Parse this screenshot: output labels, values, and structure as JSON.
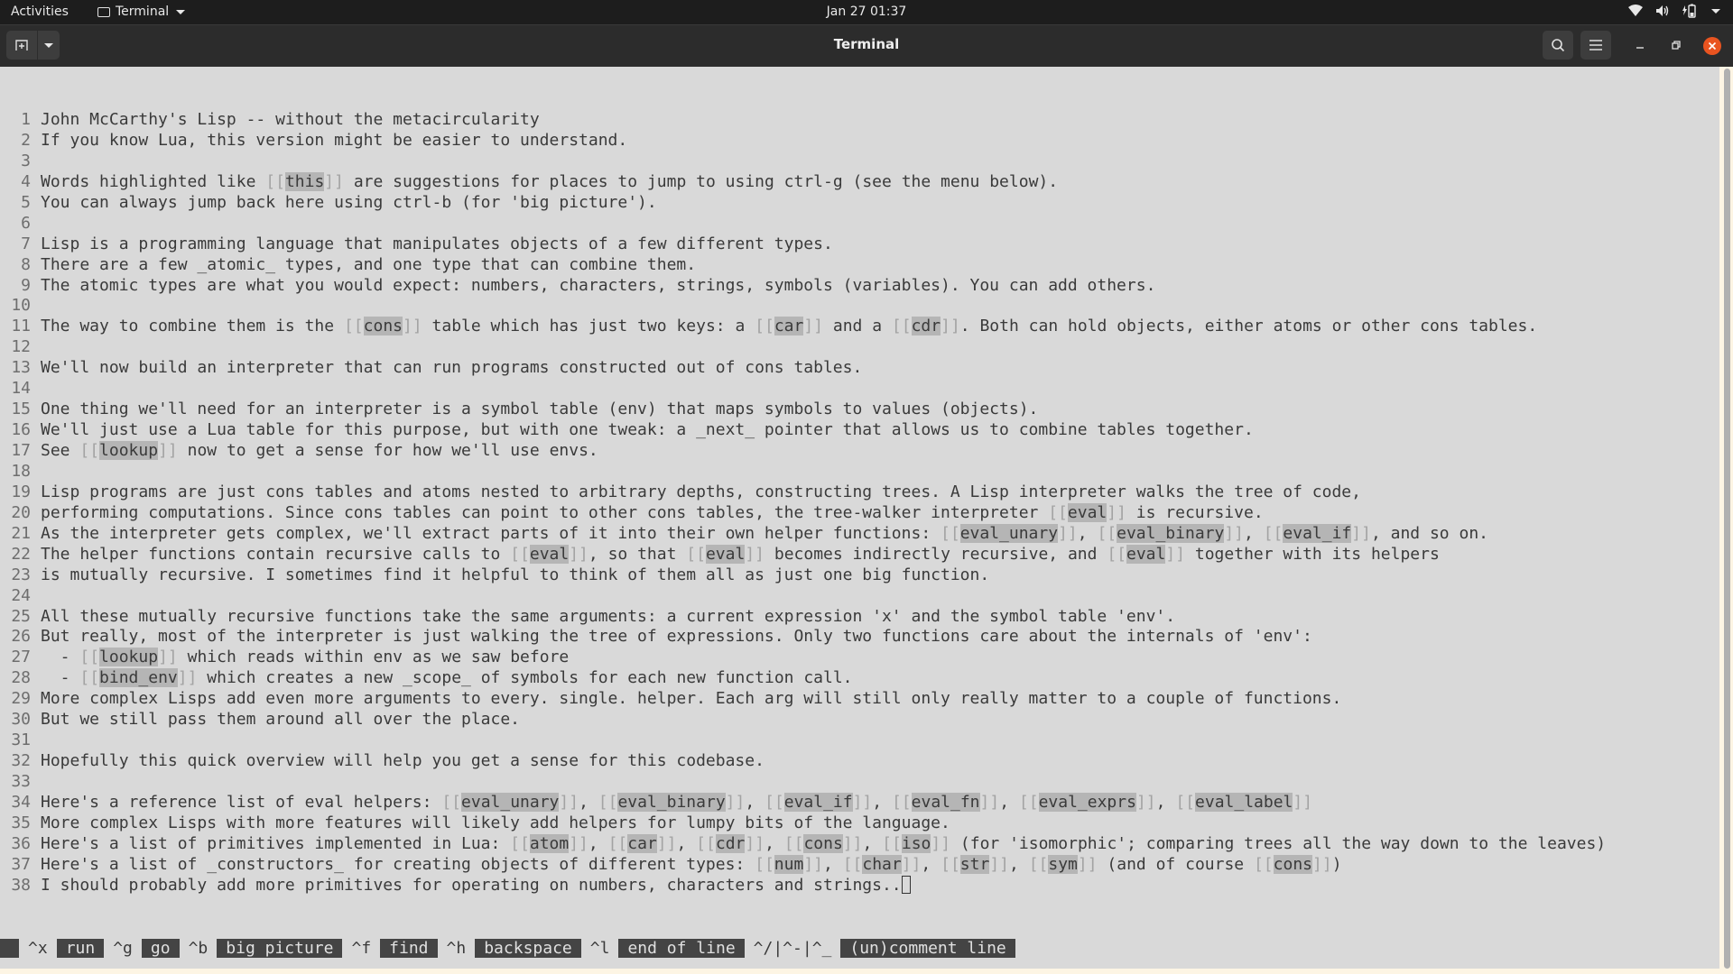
{
  "topbar": {
    "activities": "Activities",
    "app_name": "Terminal",
    "clock": "Jan 27  01:37",
    "tray_icons": [
      "wifi-icon",
      "volume-icon",
      "battery-icon",
      "system-menu-icon"
    ]
  },
  "window": {
    "title": "Terminal"
  },
  "terminal": {
    "lines": [
      [
        {
          "t": "John McCarthy's Lisp -- without the metacircularity"
        }
      ],
      [
        {
          "t": "If you know Lua, this version might be easier to understand."
        }
      ],
      [],
      [
        {
          "t": "Words highlighted like "
        },
        {
          "link": "this"
        },
        {
          "t": " are suggestions for places to jump to using ctrl-g (see the menu below)."
        }
      ],
      [
        {
          "t": "You can always jump back here using ctrl-b (for 'big picture')."
        }
      ],
      [],
      [
        {
          "t": "Lisp is a programming language that manipulates objects of a few different types."
        }
      ],
      [
        {
          "t": "There are a few _atomic_ types, and one type that can combine them."
        }
      ],
      [
        {
          "t": "The atomic types are what you would expect: numbers, characters, strings, symbols (variables). You can add others."
        }
      ],
      [],
      [
        {
          "t": "The way to combine them is the "
        },
        {
          "link": "cons"
        },
        {
          "t": " table which has just two keys: a "
        },
        {
          "link": "car"
        },
        {
          "t": " and a "
        },
        {
          "link": "cdr"
        },
        {
          "t": ". Both can hold objects, either atoms or other cons tables."
        }
      ],
      [],
      [
        {
          "t": "We'll now build an interpreter that can run programs constructed out of cons tables."
        }
      ],
      [],
      [
        {
          "t": "One thing we'll need for an interpreter is a symbol table (env) that maps symbols to values (objects)."
        }
      ],
      [
        {
          "t": "We'll just use a Lua table for this purpose, but with one tweak: a _next_ pointer that allows us to combine tables together."
        }
      ],
      [
        {
          "t": "See "
        },
        {
          "link": "lookup"
        },
        {
          "t": " now to get a sense for how we'll use envs."
        }
      ],
      [],
      [
        {
          "t": "Lisp programs are just cons tables and atoms nested to arbitrary depths, constructing trees. A Lisp interpreter walks the tree of code,"
        }
      ],
      [
        {
          "t": "performing computations. Since cons tables can point to other cons tables, the tree-walker interpreter "
        },
        {
          "link": "eval"
        },
        {
          "t": " is recursive."
        }
      ],
      [
        {
          "t": "As the interpreter gets complex, we'll extract parts of it into their own helper functions: "
        },
        {
          "link": "eval_unary"
        },
        {
          "t": ", "
        },
        {
          "link": "eval_binary"
        },
        {
          "t": ", "
        },
        {
          "link": "eval_if"
        },
        {
          "t": ", and so on."
        }
      ],
      [
        {
          "t": "The helper functions contain recursive calls to "
        },
        {
          "link": "eval"
        },
        {
          "t": ", so that "
        },
        {
          "link": "eval"
        },
        {
          "t": " becomes indirectly recursive, and "
        },
        {
          "link": "eval"
        },
        {
          "t": " together with its helpers"
        }
      ],
      [
        {
          "t": "is mutually recursive. I sometimes find it helpful to think of them all as just one big function."
        }
      ],
      [],
      [
        {
          "t": "All these mutually recursive functions take the same arguments: a current expression 'x' and the symbol table 'env'."
        }
      ],
      [
        {
          "t": "But really, most of the interpreter is just walking the tree of expressions. Only two functions care about the internals of 'env':"
        }
      ],
      [
        {
          "t": "  - "
        },
        {
          "link": "lookup"
        },
        {
          "t": " which reads within env as we saw before"
        }
      ],
      [
        {
          "t": "  - "
        },
        {
          "link": "bind_env"
        },
        {
          "t": " which creates a new _scope_ of symbols for each new function call."
        }
      ],
      [
        {
          "t": "More complex Lisps add even more arguments to every. single. helper. Each arg will still only really matter to a couple of functions."
        }
      ],
      [
        {
          "t": "But we still pass them around all over the place."
        }
      ],
      [],
      [
        {
          "t": "Hopefully this quick overview will help you get a sense for this codebase."
        }
      ],
      [],
      [
        {
          "t": "Here's a reference list of eval helpers: "
        },
        {
          "link": "eval_unary"
        },
        {
          "t": ", "
        },
        {
          "link": "eval_binary"
        },
        {
          "t": ", "
        },
        {
          "link": "eval_if"
        },
        {
          "t": ", "
        },
        {
          "link": "eval_fn"
        },
        {
          "t": ", "
        },
        {
          "link": "eval_exprs"
        },
        {
          "t": ", "
        },
        {
          "link": "eval_label"
        }
      ],
      [
        {
          "t": "More complex Lisps with more features will likely add helpers for lumpy bits of the language."
        }
      ],
      [
        {
          "t": "Here's a list of primitives implemented in Lua: "
        },
        {
          "link": "atom"
        },
        {
          "t": ", "
        },
        {
          "link": "car"
        },
        {
          "t": ", "
        },
        {
          "link": "cdr"
        },
        {
          "t": ", "
        },
        {
          "link": "cons"
        },
        {
          "t": ", "
        },
        {
          "link": "iso"
        },
        {
          "t": " (for 'isomorphic'; comparing trees all the way down to the leaves)"
        }
      ],
      [
        {
          "t": "Here's a list of _constructors_ for creating objects of different types: "
        },
        {
          "link": "num"
        },
        {
          "t": ", "
        },
        {
          "link": "char"
        },
        {
          "t": ", "
        },
        {
          "link": "str"
        },
        {
          "t": ", "
        },
        {
          "link": "sym"
        },
        {
          "t": " (and of course "
        },
        {
          "link": "cons"
        },
        {
          "t": ")"
        }
      ],
      [
        {
          "t": "I should probably add more primitives for operating on numbers, characters and strings.."
        },
        {
          "cursor": true
        }
      ]
    ],
    "menu": [
      {
        "key": "^x",
        "label": "run"
      },
      {
        "key": "^g",
        "label": "go"
      },
      {
        "key": "^b",
        "label": "big picture"
      },
      {
        "key": "^f",
        "label": "find"
      },
      {
        "key": "^h",
        "label": "backspace"
      },
      {
        "key": "^l",
        "label": "end of line"
      },
      {
        "key": "^/|^-|^_",
        "label": "(un)comment line"
      }
    ]
  }
}
